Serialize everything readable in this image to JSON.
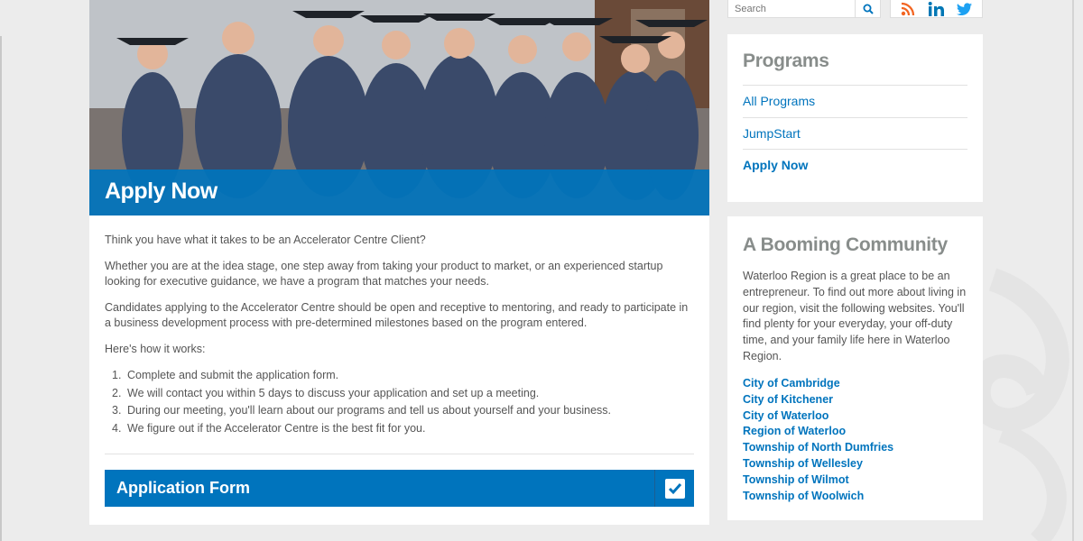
{
  "hero": {
    "title": "Apply Now"
  },
  "content": {
    "intro": "Think you have what it takes to be an Accelerator Centre Client?",
    "para1": "Whether you are at the idea stage, one step away from taking your product to market, or an experienced startup looking for executive guidance, we have a program that matches your needs.",
    "para2": "Candidates applying to the Accelerator Centre should be open and receptive to mentoring, and ready to participate in a business development process with pre-determined milestones based on the program entered.",
    "how": "Here's how it works:",
    "steps": [
      {
        "num": "1.",
        "text": "Complete and submit the application form."
      },
      {
        "num": "2.",
        "text": "We will contact you within 5 days to discuss your application and set up a meeting."
      },
      {
        "num": "3.",
        "text": "During our meeting, you'll learn about our programs and tell us about yourself and your business."
      },
      {
        "num": "4.",
        "text": "We figure out if the Accelerator Centre is the best fit for you."
      }
    ]
  },
  "application_form": {
    "label": "Application Form",
    "icon": "checkbox-icon"
  },
  "search": {
    "placeholder": "Search",
    "icon": "search-icon"
  },
  "social": {
    "icons": [
      "rss-icon",
      "linkedin-icon",
      "twitter-icon"
    ]
  },
  "programs": {
    "title": "Programs",
    "items": [
      {
        "label": "All Programs"
      },
      {
        "label": "JumpStart"
      },
      {
        "label": "Apply Now"
      }
    ]
  },
  "community": {
    "title": "A Booming Community",
    "text": "Waterloo Region is a great place to be an entrepreneur. To find out more about living in our region, visit the following websites. You'll find plenty for your everyday, your off-duty time, and your family life here in Waterloo Region.",
    "links": [
      "City of Cambridge",
      "City of Kitchener",
      "City of Waterloo",
      "Region of Waterloo",
      "Township of North Dumfries",
      "Township of Wellesley",
      "Township of Wilmot",
      "Township of Woolwich"
    ]
  },
  "colors": {
    "brand_blue": "#0074bd",
    "heading_gray": "#888d8b",
    "body_text": "#555555",
    "rss": "#f26522",
    "linkedin": "#0077b5",
    "twitter": "#1da1f2"
  }
}
